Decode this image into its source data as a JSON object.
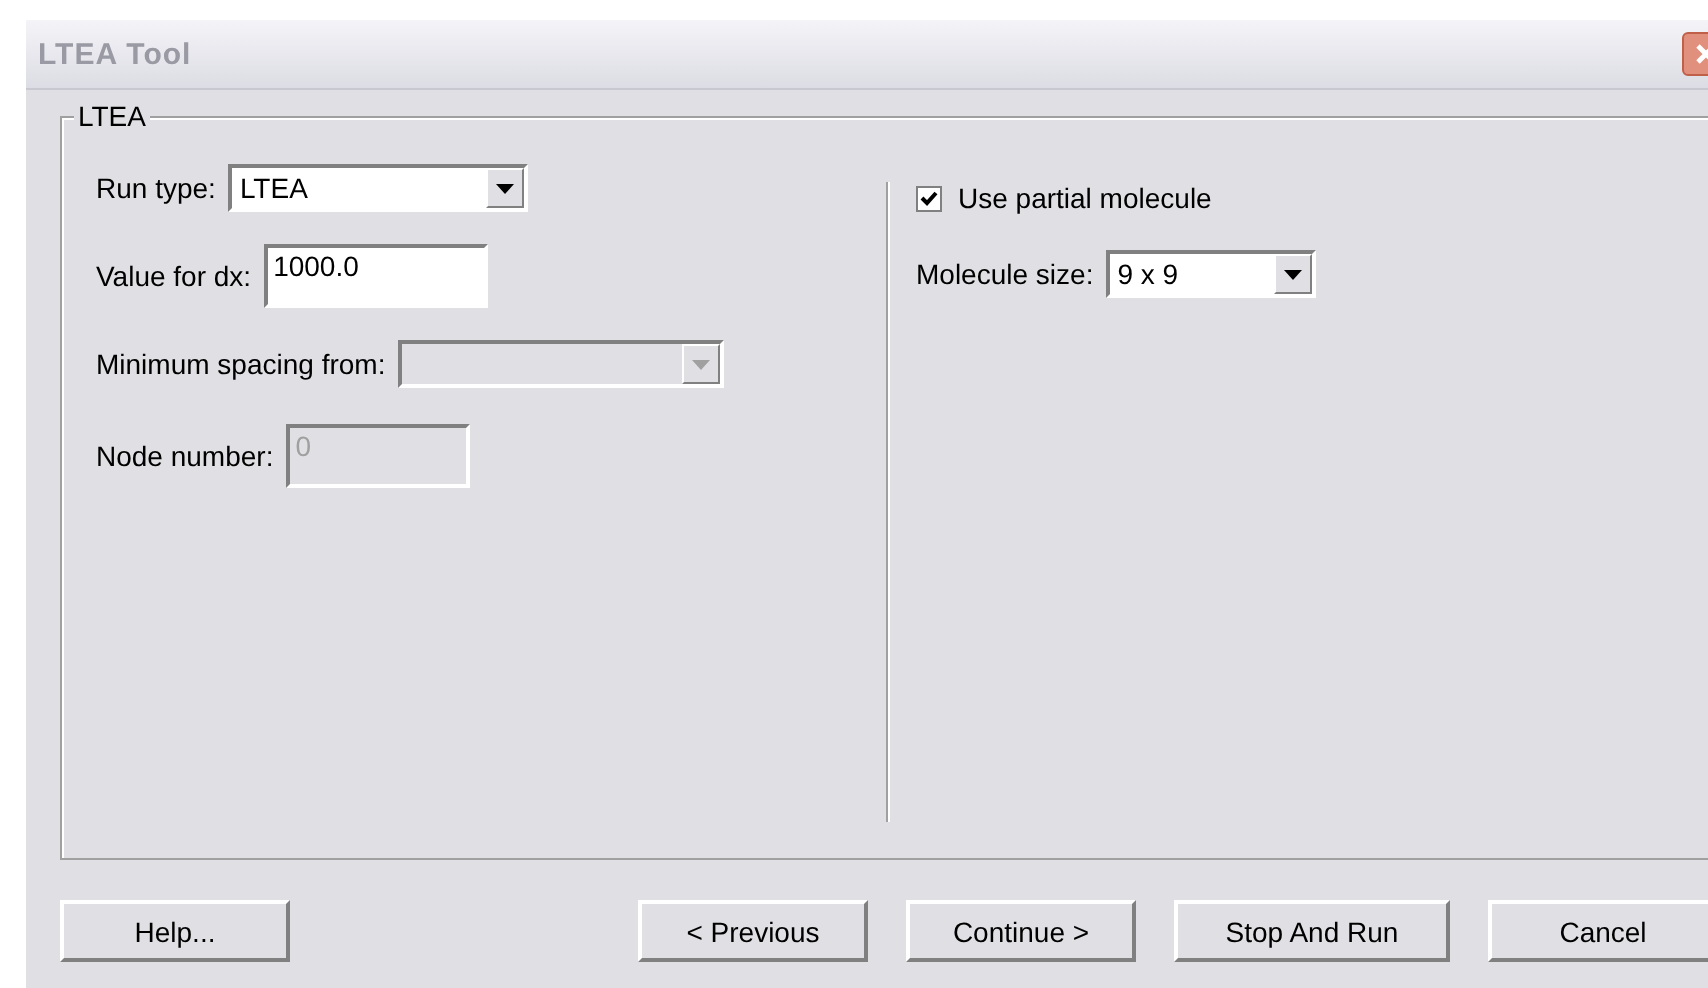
{
  "window": {
    "title": "LTEA Tool"
  },
  "group": {
    "title": "LTEA"
  },
  "left": {
    "run_type": {
      "label": "Run type:",
      "value": "LTEA",
      "disabled": false
    },
    "dx": {
      "label": "Value for dx:",
      "value": "1000.0",
      "disabled": false
    },
    "min_spacing": {
      "label": "Minimum spacing from:",
      "disabled": true
    },
    "node": {
      "label": "Node number:",
      "value": "0",
      "disabled": true
    }
  },
  "right": {
    "partial": {
      "label": "Use partial molecule",
      "checked": true
    },
    "size": {
      "label": "Molecule size:",
      "value": "9 x 9",
      "disabled": false
    }
  },
  "buttons": [
    "Help...",
    "< Previous",
    "Continue >",
    "Stop And Run",
    "Cancel"
  ]
}
